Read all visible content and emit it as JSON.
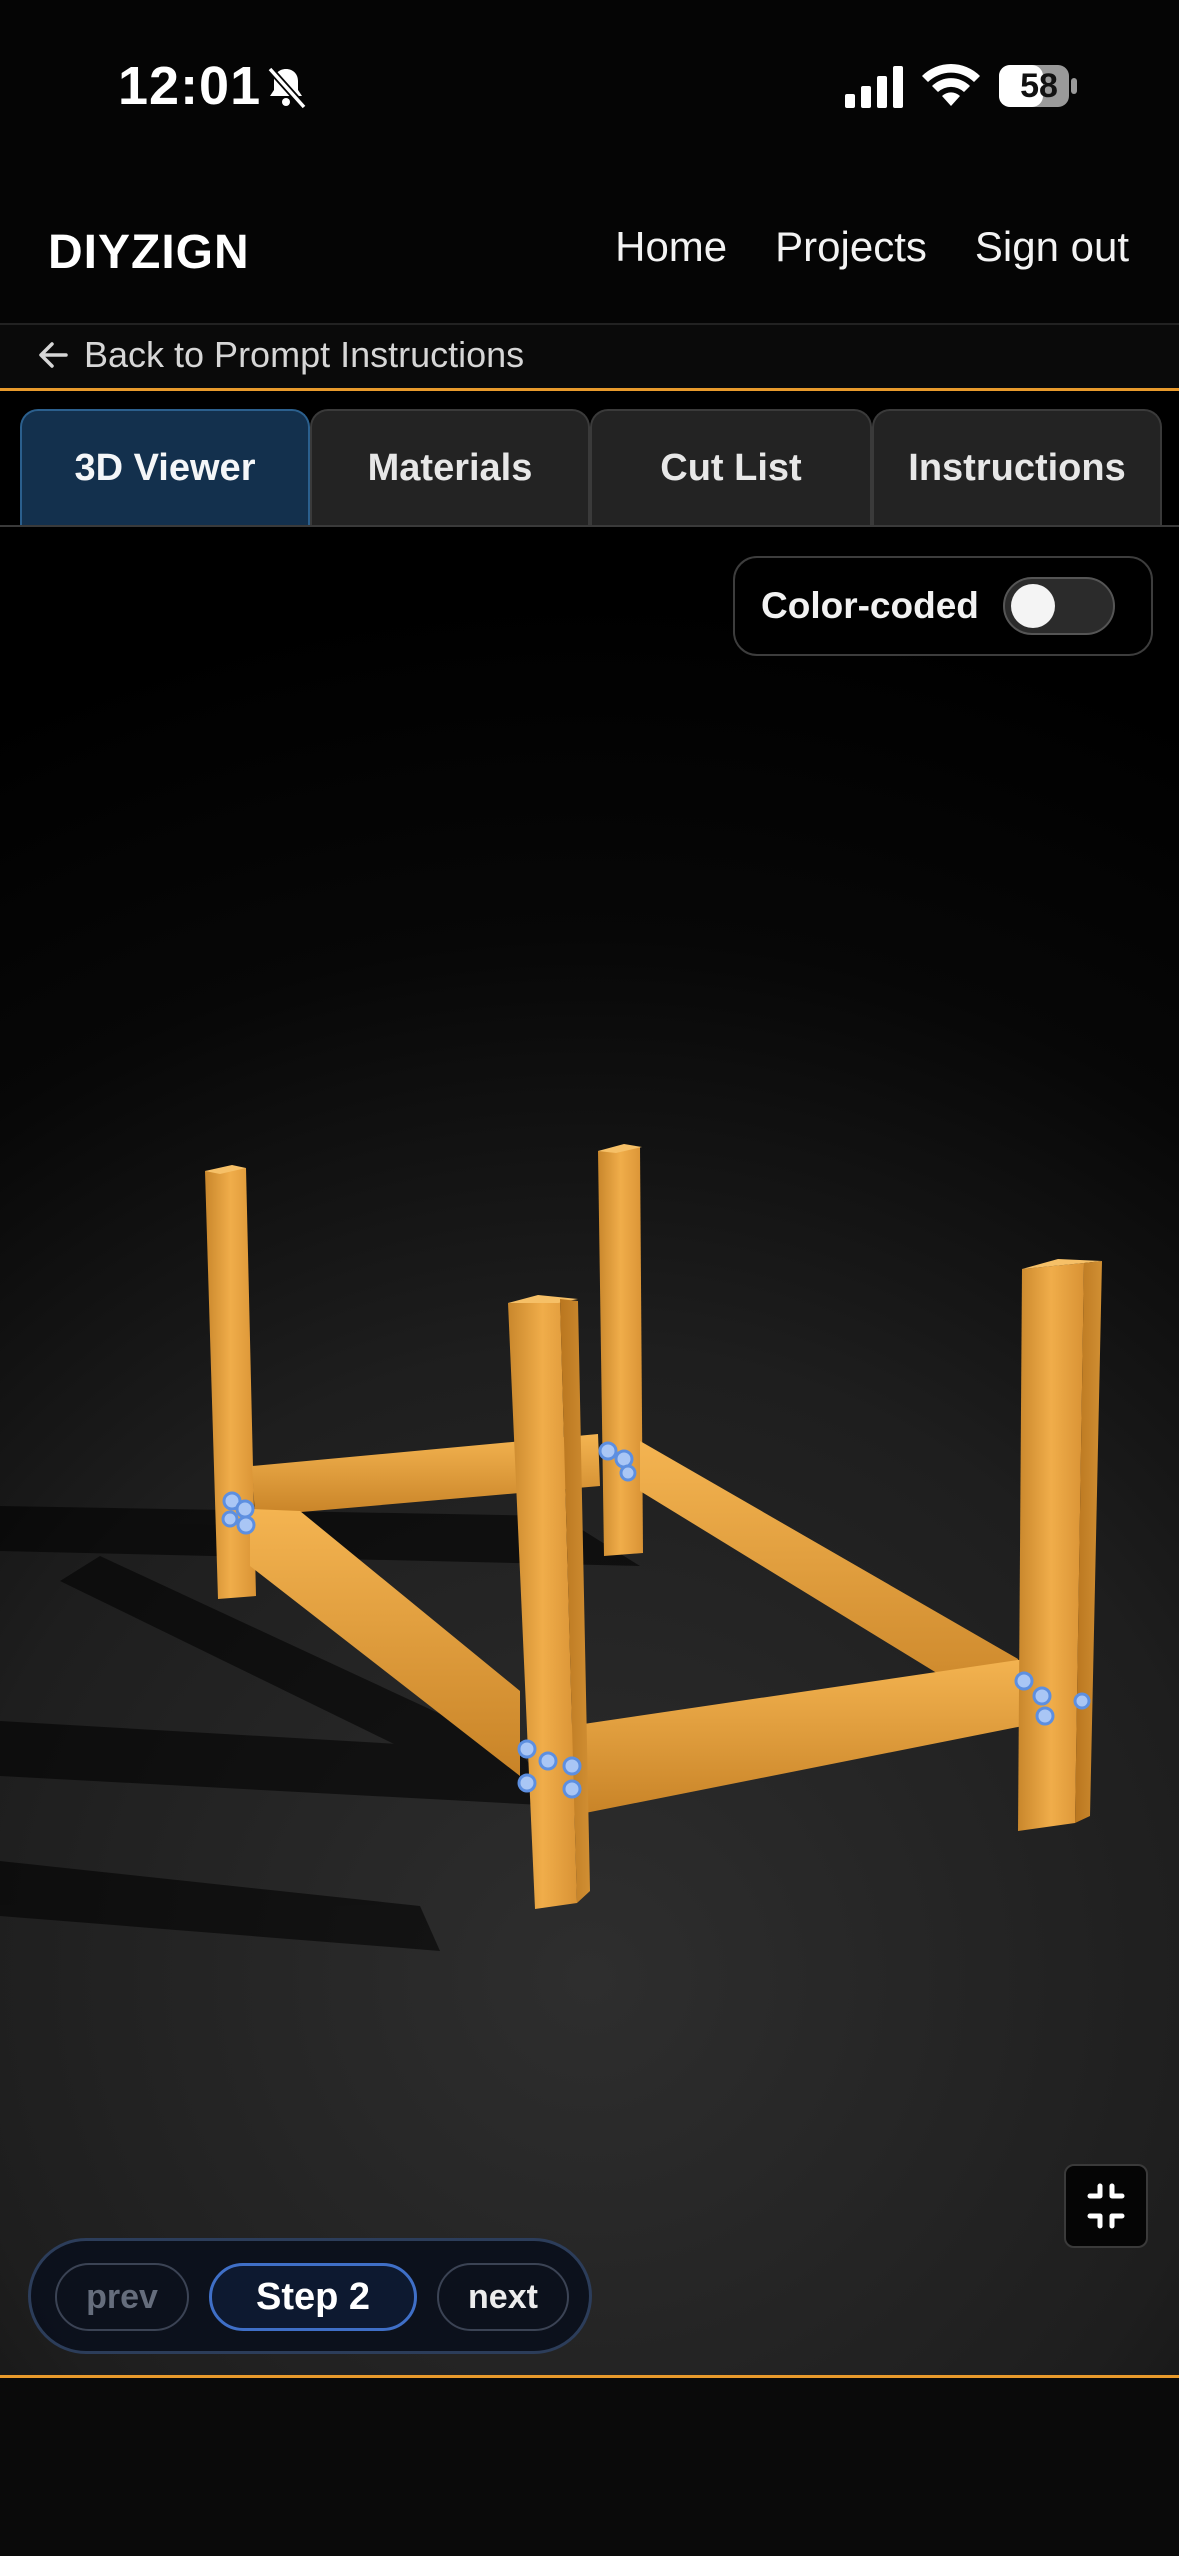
{
  "status_bar": {
    "time": "12:01",
    "battery": "58"
  },
  "header": {
    "brand": "DIYZIGN",
    "nav": [
      "Home",
      "Projects",
      "Sign out"
    ]
  },
  "back_link": "Back to Prompt Instructions",
  "tabs": [
    {
      "label": "3D Viewer",
      "active": true
    },
    {
      "label": "Materials",
      "active": false
    },
    {
      "label": "Cut List",
      "active": false
    },
    {
      "label": "Instructions",
      "active": false
    }
  ],
  "viewer": {
    "color_coded_label": "Color-coded",
    "color_coded_on": false
  },
  "step_nav": {
    "prev": "prev",
    "step": "Step 2",
    "next": "next"
  },
  "colors": {
    "accent_orange": "#e89a2c",
    "active_tab": "#13304d",
    "wood": "#e8a543",
    "step_border": "#3f6fc7"
  },
  "icons": [
    "bell-slash-icon",
    "signal-icon",
    "wifi-icon",
    "battery-icon",
    "arrow-left-icon",
    "collapse-icon"
  ]
}
